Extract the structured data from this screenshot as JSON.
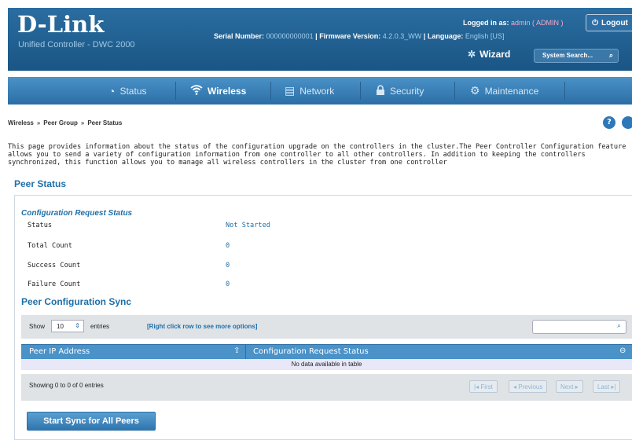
{
  "header": {
    "brand": "D-Link",
    "product": "Unified Controller - DWC 2000",
    "serial_label": "Serial Number:",
    "serial_value": "000000000001",
    "firmware_label": "Firmware Version:",
    "firmware_value": "4.2.0.3_WW",
    "language_label": "Language:",
    "language_value": "English [US]",
    "separator": "|",
    "logged_label": "Logged in as:",
    "logged_value": "admin ( ADMIN )",
    "logout_label": "Logout",
    "wizard_label": "Wizard",
    "search_placeholder": "System Search..."
  },
  "nav": {
    "items": [
      {
        "label": "Status",
        "icon": "gauge-icon"
      },
      {
        "label": "Wireless",
        "icon": "wifi-icon",
        "active": true
      },
      {
        "label": "Network",
        "icon": "network-icon"
      },
      {
        "label": "Security",
        "icon": "lock-icon"
      },
      {
        "label": "Maintenance",
        "icon": "gears-icon"
      }
    ]
  },
  "breadcrumb": {
    "items": [
      "Wireless",
      "Peer Group",
      "Peer Status"
    ],
    "separator": "»"
  },
  "help_label": "?",
  "description": "This page provides information about the status of the configuration upgrade on the controllers in the cluster.The Peer Controller Configuration feature allows you to send a variety of configuration information from one controller to all other controllers. In addition to keeping the controllers synchronized, this function allows you to manage all wireless controllers in the cluster from one controller",
  "page_title": "Peer Status",
  "config_request": {
    "title": "Configuration Request Status",
    "rows": [
      {
        "label": "Status",
        "value": "Not Started"
      },
      {
        "label": "Total Count",
        "value": "0"
      },
      {
        "label": "Success Count",
        "value": "0"
      },
      {
        "label": "Failure Count",
        "value": "0"
      }
    ]
  },
  "sync": {
    "title": "Peer Configuration Sync",
    "show_label": "Show",
    "show_value": "10",
    "entries_label": "entries",
    "hint": "[Right click row to see more options]",
    "columns": [
      "Peer IP Address",
      "Configuration Request Status"
    ],
    "empty_text": "No data available in table",
    "showing_text": "Showing 0 to 0 of 0 entries",
    "pagination": [
      "First",
      "Previous",
      "Next",
      "Last"
    ],
    "button_label": "Start Sync for All Peers"
  },
  "colors": {
    "header_blue": "#1e5a8a",
    "nav_blue": "#3a80b8",
    "title_blue": "#1e6fa8",
    "table_header": "#4a92c8"
  }
}
